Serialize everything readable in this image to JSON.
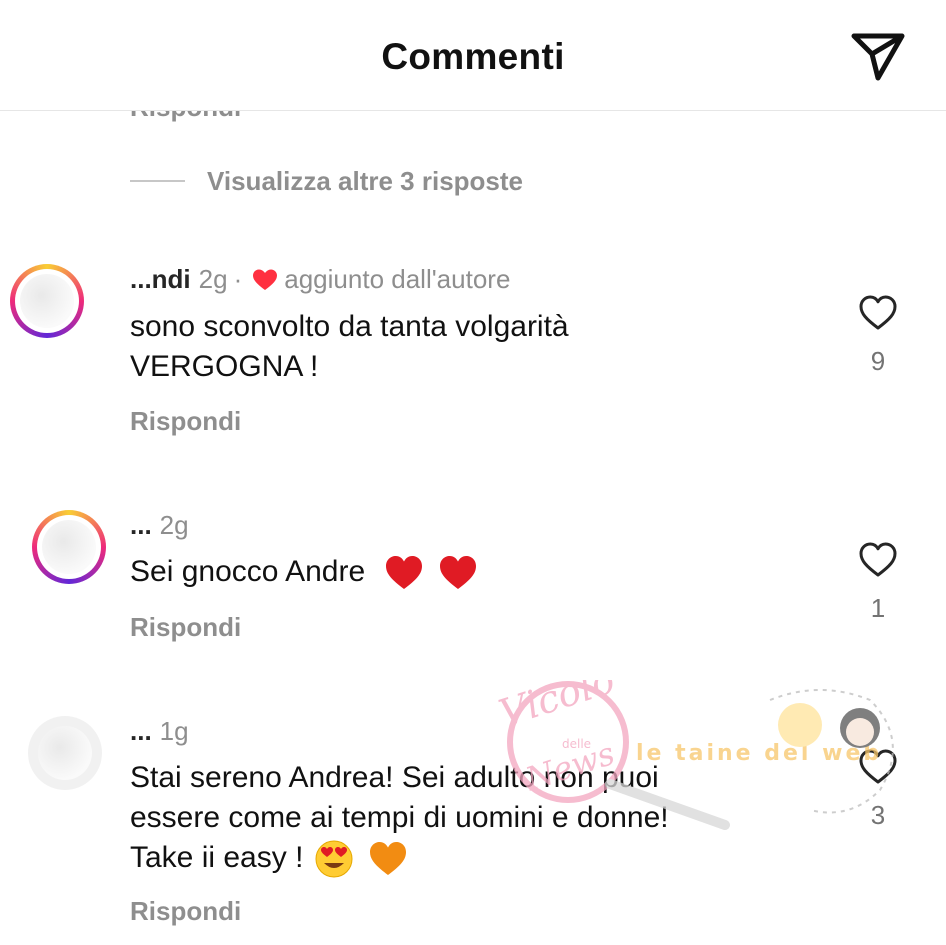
{
  "header": {
    "title": "Commenti",
    "send_icon": "send-icon"
  },
  "peek_reply_label": "Rispondi",
  "more_replies": {
    "label": "Visualizza altre 3 risposte"
  },
  "comments": [
    {
      "username": "...ndi",
      "time": "2g",
      "separator": "·",
      "badge": "aggiunto dall'autore",
      "text_lines": [
        "sono sconvolto da tanta volgarità",
        "VERGOGNA !"
      ],
      "reply_label": "Rispondi",
      "likes": "9"
    },
    {
      "username": "...",
      "time": "2g",
      "text": "Sei gnocco Andre",
      "emojis": [
        "red-heart",
        "red-heart"
      ],
      "reply_label": "Rispondi",
      "likes": "1"
    },
    {
      "username": "...",
      "time": "1g",
      "text_lines": [
        "Stai sereno Andrea! Sei adulto non puoi",
        "essere come ai tempi di uomini e donne!",
        "Take ii easy !"
      ],
      "emojis": [
        "heart-eyes",
        "orange-heart"
      ],
      "reply_label": "Rispondi",
      "likes": "3"
    }
  ],
  "watermark": {
    "line1": "Vicolo",
    "line2": "delle",
    "line3": "News",
    "line4": "le taine del web"
  },
  "colors": {
    "muted": "#8e8e8e",
    "text": "#111111",
    "heart_red": "#ff3040",
    "divider": "#e6e6e6"
  }
}
